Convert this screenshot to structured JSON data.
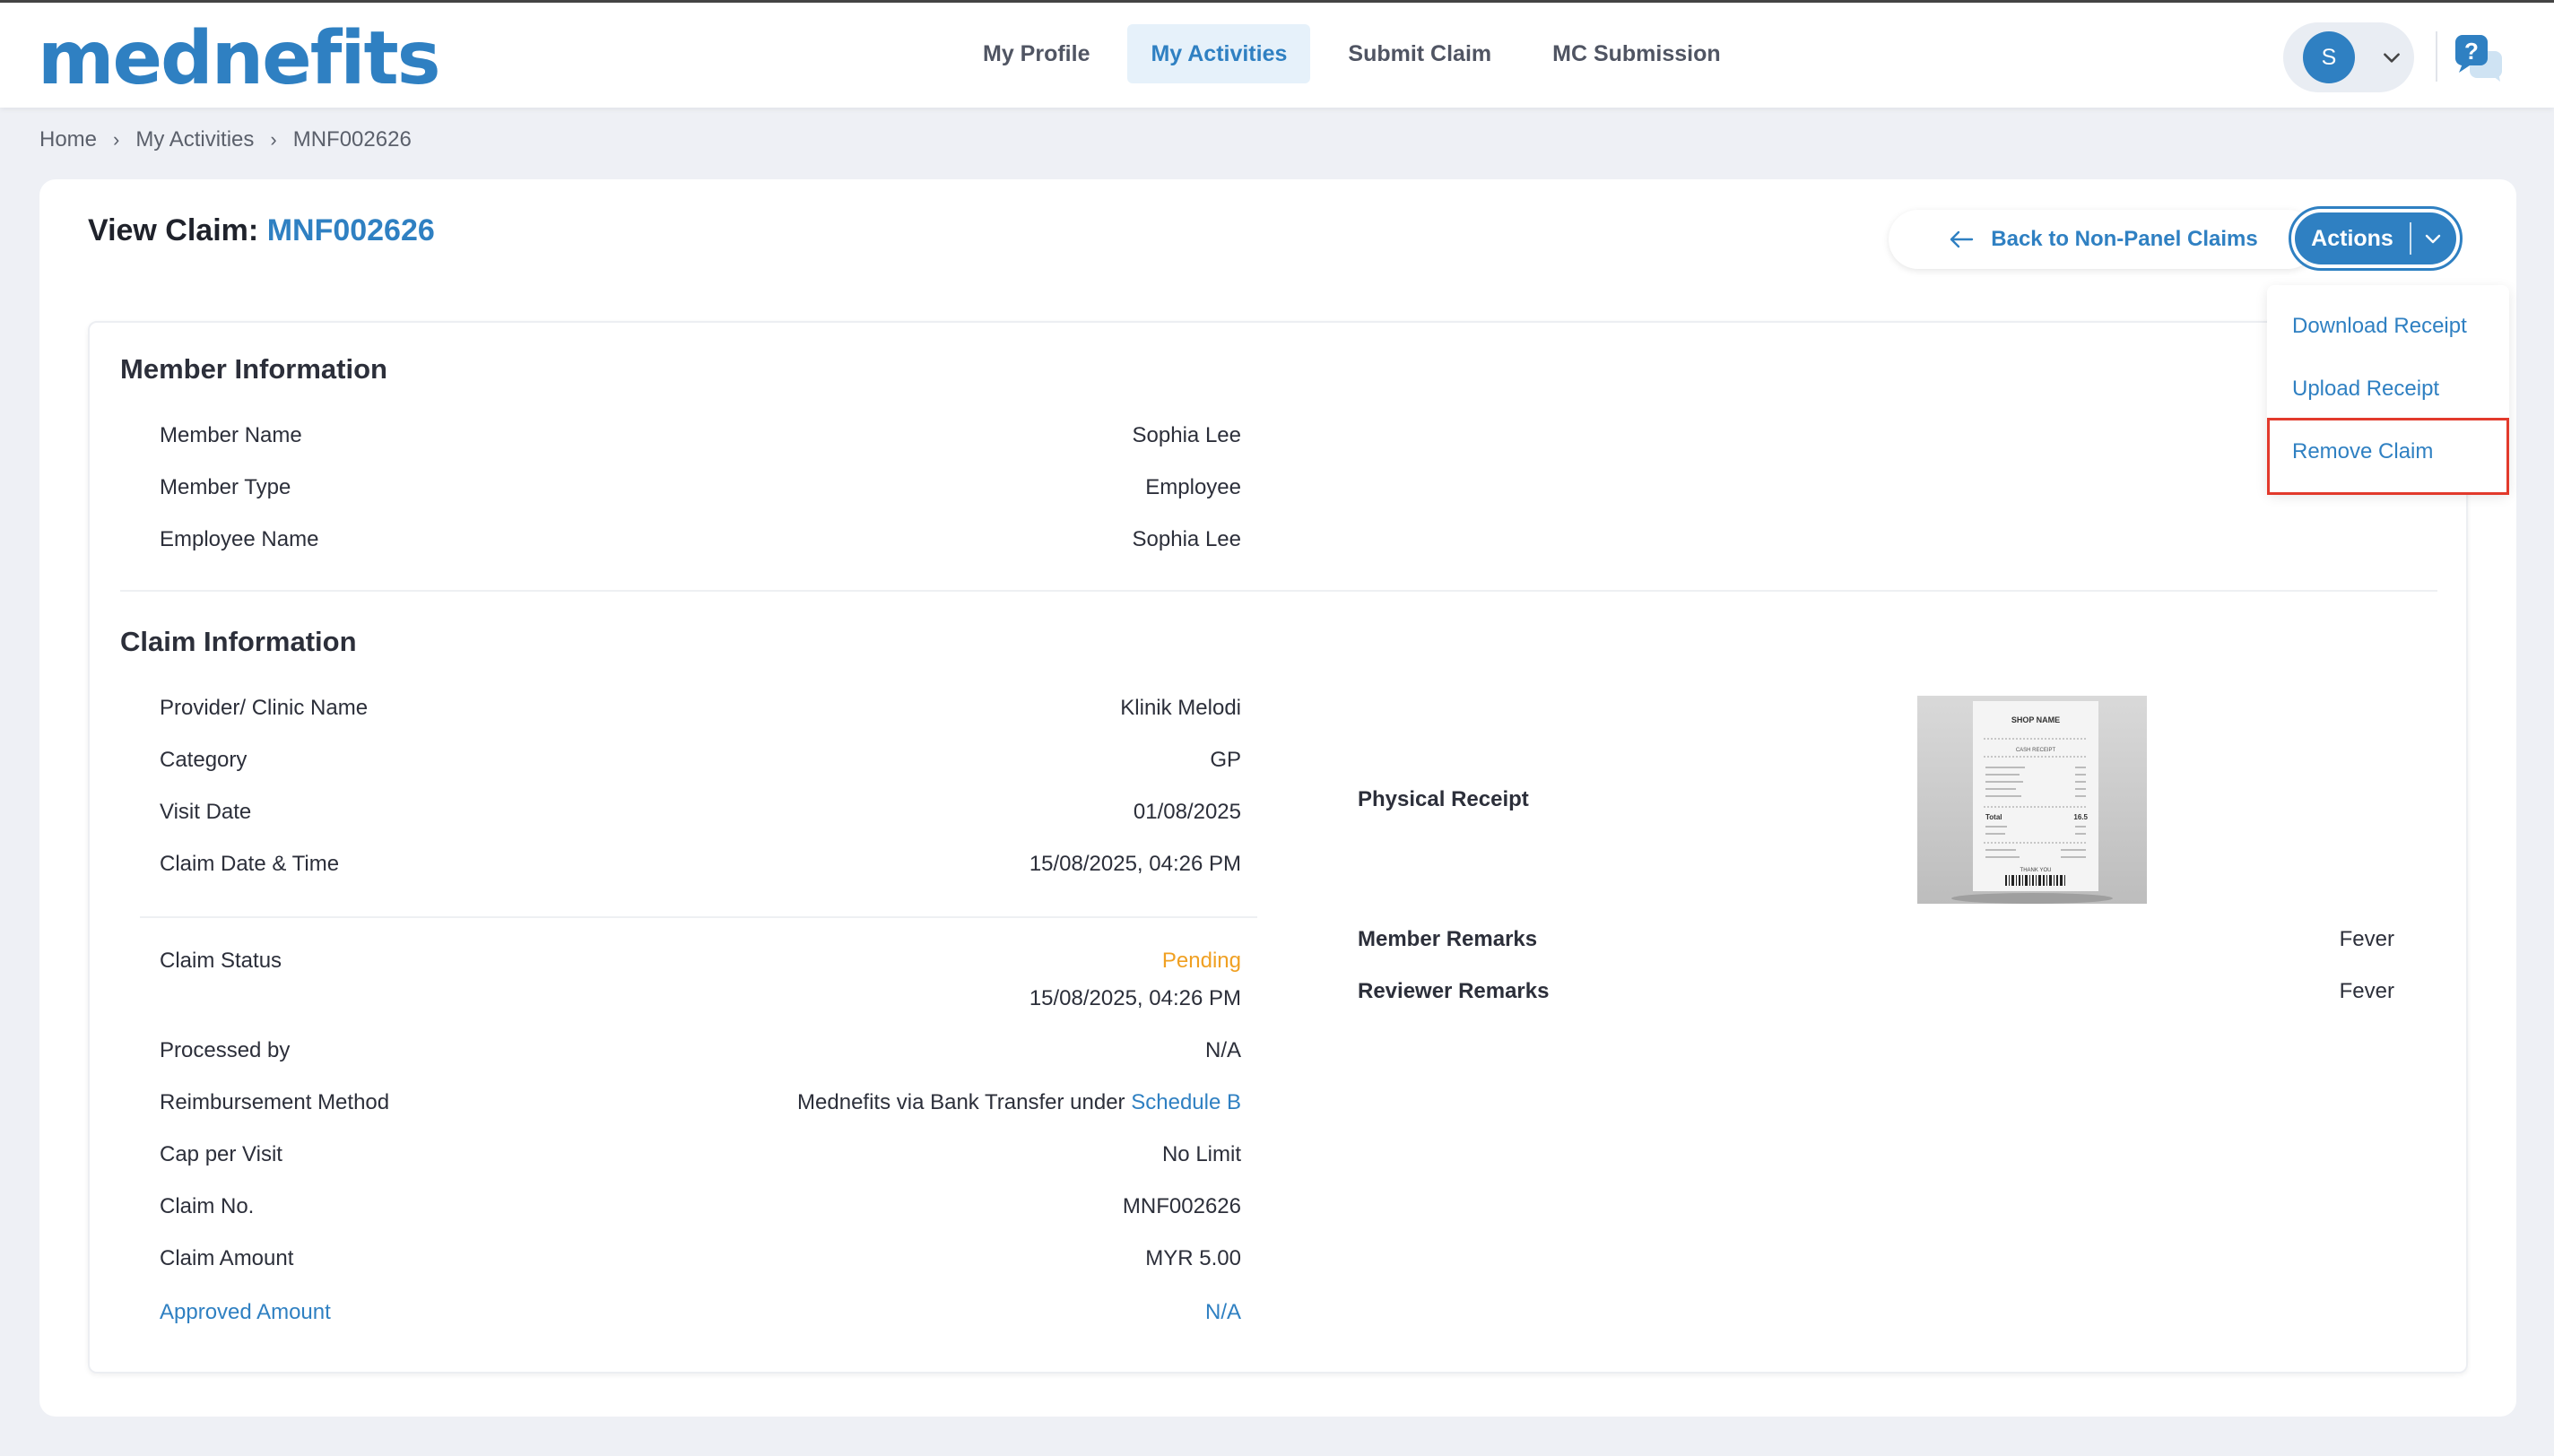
{
  "brand": {
    "logo_text": "mednefits",
    "accent": "#2f80c2"
  },
  "nav": {
    "items": [
      {
        "label": "My Profile"
      },
      {
        "label": "My Activities",
        "active": true
      },
      {
        "label": "Submit Claim"
      },
      {
        "label": "MC Submission"
      }
    ],
    "user_initial": "S",
    "help_icon": "help-chat-icon"
  },
  "breadcrumb": {
    "items": [
      "Home",
      "My Activities",
      "MNF002626"
    ]
  },
  "page": {
    "title_prefix": "View Claim:",
    "claim_id": "MNF002626",
    "back_button": "Back to Non-Panel Claims",
    "actions_button": "Actions",
    "actions_menu": [
      "Download Receipt",
      "Upload Receipt",
      "Remove Claim"
    ],
    "highlighted_menu_item": "Remove Claim"
  },
  "member_information": {
    "title": "Member Information",
    "rows": [
      {
        "label": "Member Name",
        "value": "Sophia Lee"
      },
      {
        "label": "Member Type",
        "value": "Employee"
      },
      {
        "label": "Employee Name",
        "value": "Sophia Lee"
      }
    ]
  },
  "claim_information": {
    "title": "Claim Information",
    "rows_top": [
      {
        "label": "Provider/ Clinic Name",
        "value": "Klinik Melodi"
      },
      {
        "label": "Category",
        "value": "GP"
      },
      {
        "label": "Visit Date",
        "value": "01/08/2025"
      },
      {
        "label": "Claim Date & Time",
        "value": "15/08/2025, 04:26 PM"
      }
    ],
    "status": {
      "label": "Claim Status",
      "value": "Pending",
      "timestamp": "15/08/2025, 04:26 PM",
      "color": "#f0a022"
    },
    "rows_bottom": [
      {
        "label": "Processed by",
        "value": "N/A"
      },
      {
        "label": "Reimbursement Method",
        "value": "Mednefits via Bank Transfer under",
        "link": "Schedule B"
      },
      {
        "label": "Cap per Visit",
        "value": "No Limit"
      },
      {
        "label": "Claim No.",
        "value": "MNF002626"
      },
      {
        "label": "Claim Amount",
        "value": "MYR 5.00"
      },
      {
        "label": "Approved Amount",
        "value": "N/A"
      }
    ],
    "right": {
      "physical_receipt_label": "Physical Receipt",
      "receipt_text": {
        "shop": "SHOP NAME",
        "heading": "CASH RECEIPT",
        "total_label": "Total",
        "total_value": "16.5",
        "thanks": "THANK YOU"
      },
      "member_remarks_label": "Member Remarks",
      "member_remarks": "Fever",
      "reviewer_remarks_label": "Reviewer Remarks",
      "reviewer_remarks": "Fever"
    }
  }
}
